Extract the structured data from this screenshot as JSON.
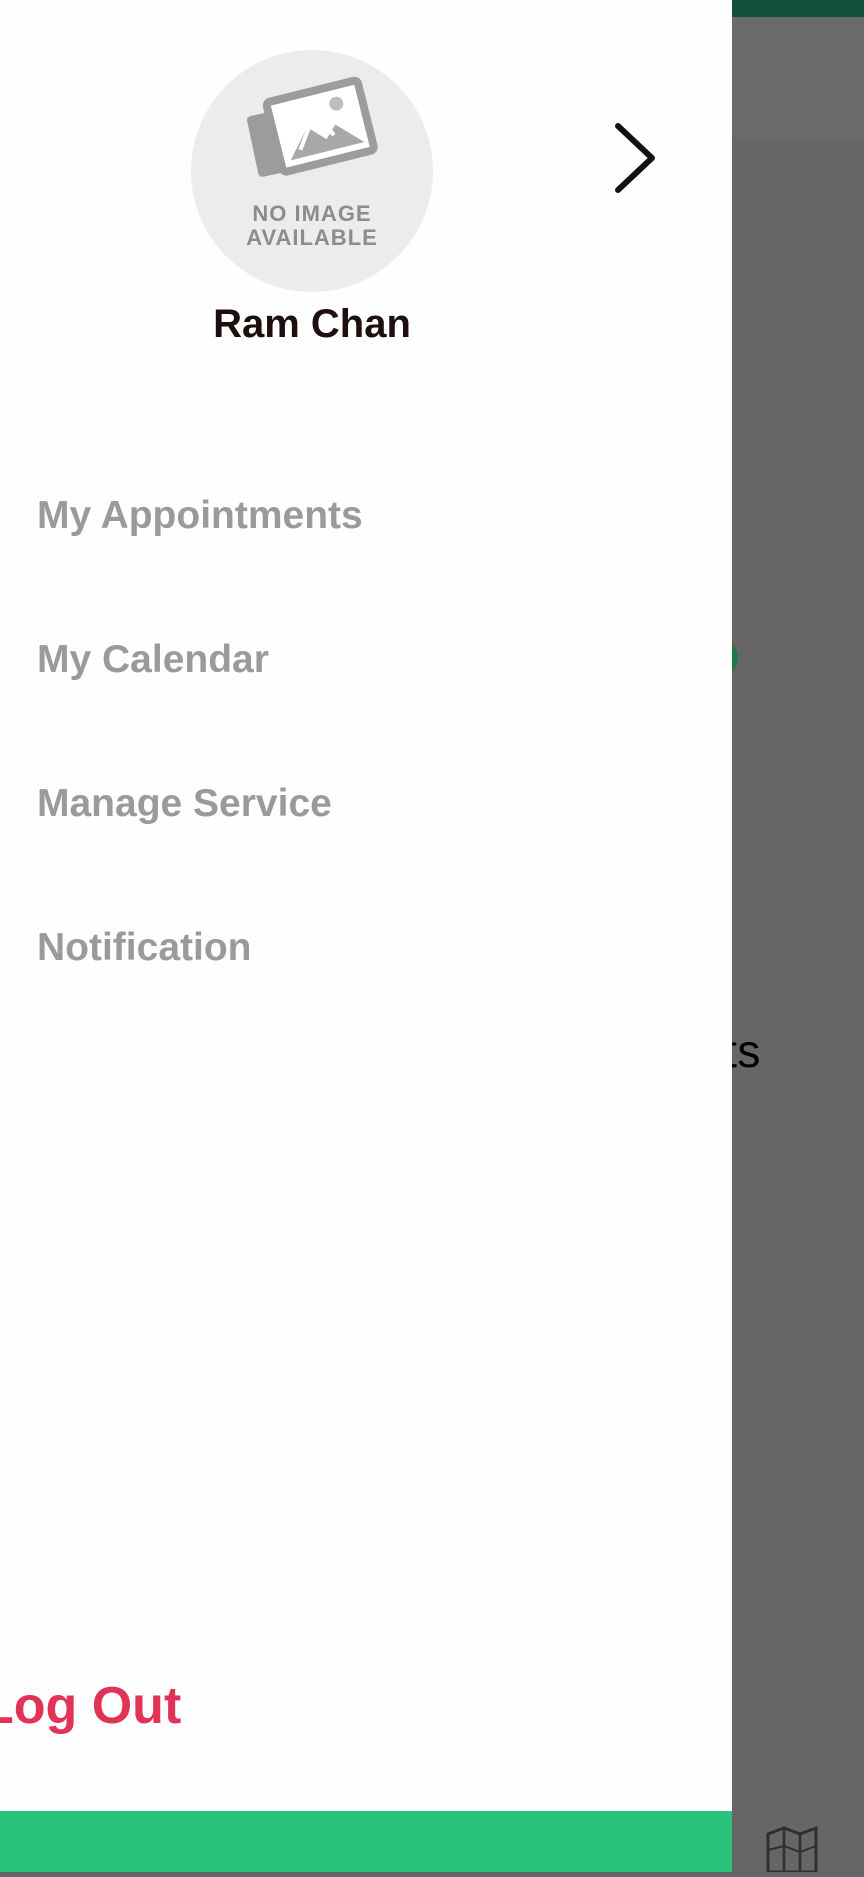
{
  "background": {
    "partial_text": "nts",
    "statusbar_color": "#15513a",
    "icons": [
      "map-icon"
    ]
  },
  "drawer": {
    "avatar": {
      "placeholder_line1": "NO IMAGE",
      "placeholder_line2": "AVAILABLE"
    },
    "user_name": "Ram Chan",
    "close_icon": "chevron-right-icon",
    "menu": [
      {
        "label": "My Appointments"
      },
      {
        "label": "My Calendar"
      },
      {
        "label": "Manage Service"
      },
      {
        "label": "Notification"
      }
    ],
    "logout_label": "Log Out",
    "colors": {
      "accent_green": "#2bc27c",
      "logout_red": "#e03357",
      "menu_text": "#9a9a9a",
      "name_text": "#1e0f0f"
    }
  }
}
